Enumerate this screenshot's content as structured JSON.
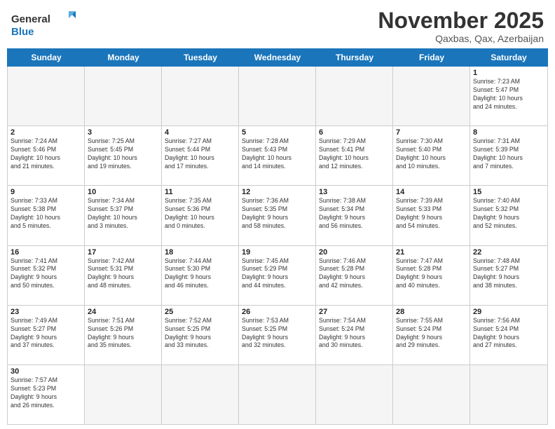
{
  "header": {
    "logo_general": "General",
    "logo_blue": "Blue",
    "month_title": "November 2025",
    "subtitle": "Qaxbas, Qax, Azerbaijan"
  },
  "weekdays": [
    "Sunday",
    "Monday",
    "Tuesday",
    "Wednesday",
    "Thursday",
    "Friday",
    "Saturday"
  ],
  "rows": [
    [
      {
        "day": "",
        "info": "",
        "empty": true
      },
      {
        "day": "",
        "info": "",
        "empty": true
      },
      {
        "day": "",
        "info": "",
        "empty": true
      },
      {
        "day": "",
        "info": "",
        "empty": true
      },
      {
        "day": "",
        "info": "",
        "empty": true
      },
      {
        "day": "",
        "info": "",
        "empty": true
      },
      {
        "day": "1",
        "info": "Sunrise: 7:23 AM\nSunset: 5:47 PM\nDaylight: 10 hours\nand 24 minutes."
      }
    ],
    [
      {
        "day": "2",
        "info": "Sunrise: 7:24 AM\nSunset: 5:46 PM\nDaylight: 10 hours\nand 21 minutes."
      },
      {
        "day": "3",
        "info": "Sunrise: 7:25 AM\nSunset: 5:45 PM\nDaylight: 10 hours\nand 19 minutes."
      },
      {
        "day": "4",
        "info": "Sunrise: 7:27 AM\nSunset: 5:44 PM\nDaylight: 10 hours\nand 17 minutes."
      },
      {
        "day": "5",
        "info": "Sunrise: 7:28 AM\nSunset: 5:43 PM\nDaylight: 10 hours\nand 14 minutes."
      },
      {
        "day": "6",
        "info": "Sunrise: 7:29 AM\nSunset: 5:41 PM\nDaylight: 10 hours\nand 12 minutes."
      },
      {
        "day": "7",
        "info": "Sunrise: 7:30 AM\nSunset: 5:40 PM\nDaylight: 10 hours\nand 10 minutes."
      },
      {
        "day": "8",
        "info": "Sunrise: 7:31 AM\nSunset: 5:39 PM\nDaylight: 10 hours\nand 7 minutes."
      }
    ],
    [
      {
        "day": "9",
        "info": "Sunrise: 7:33 AM\nSunset: 5:38 PM\nDaylight: 10 hours\nand 5 minutes."
      },
      {
        "day": "10",
        "info": "Sunrise: 7:34 AM\nSunset: 5:37 PM\nDaylight: 10 hours\nand 3 minutes."
      },
      {
        "day": "11",
        "info": "Sunrise: 7:35 AM\nSunset: 5:36 PM\nDaylight: 10 hours\nand 0 minutes."
      },
      {
        "day": "12",
        "info": "Sunrise: 7:36 AM\nSunset: 5:35 PM\nDaylight: 9 hours\nand 58 minutes."
      },
      {
        "day": "13",
        "info": "Sunrise: 7:38 AM\nSunset: 5:34 PM\nDaylight: 9 hours\nand 56 minutes."
      },
      {
        "day": "14",
        "info": "Sunrise: 7:39 AM\nSunset: 5:33 PM\nDaylight: 9 hours\nand 54 minutes."
      },
      {
        "day": "15",
        "info": "Sunrise: 7:40 AM\nSunset: 5:32 PM\nDaylight: 9 hours\nand 52 minutes."
      }
    ],
    [
      {
        "day": "16",
        "info": "Sunrise: 7:41 AM\nSunset: 5:32 PM\nDaylight: 9 hours\nand 50 minutes."
      },
      {
        "day": "17",
        "info": "Sunrise: 7:42 AM\nSunset: 5:31 PM\nDaylight: 9 hours\nand 48 minutes."
      },
      {
        "day": "18",
        "info": "Sunrise: 7:44 AM\nSunset: 5:30 PM\nDaylight: 9 hours\nand 46 minutes."
      },
      {
        "day": "19",
        "info": "Sunrise: 7:45 AM\nSunset: 5:29 PM\nDaylight: 9 hours\nand 44 minutes."
      },
      {
        "day": "20",
        "info": "Sunrise: 7:46 AM\nSunset: 5:28 PM\nDaylight: 9 hours\nand 42 minutes."
      },
      {
        "day": "21",
        "info": "Sunrise: 7:47 AM\nSunset: 5:28 PM\nDaylight: 9 hours\nand 40 minutes."
      },
      {
        "day": "22",
        "info": "Sunrise: 7:48 AM\nSunset: 5:27 PM\nDaylight: 9 hours\nand 38 minutes."
      }
    ],
    [
      {
        "day": "23",
        "info": "Sunrise: 7:49 AM\nSunset: 5:27 PM\nDaylight: 9 hours\nand 37 minutes."
      },
      {
        "day": "24",
        "info": "Sunrise: 7:51 AM\nSunset: 5:26 PM\nDaylight: 9 hours\nand 35 minutes."
      },
      {
        "day": "25",
        "info": "Sunrise: 7:52 AM\nSunset: 5:25 PM\nDaylight: 9 hours\nand 33 minutes."
      },
      {
        "day": "26",
        "info": "Sunrise: 7:53 AM\nSunset: 5:25 PM\nDaylight: 9 hours\nand 32 minutes."
      },
      {
        "day": "27",
        "info": "Sunrise: 7:54 AM\nSunset: 5:24 PM\nDaylight: 9 hours\nand 30 minutes."
      },
      {
        "day": "28",
        "info": "Sunrise: 7:55 AM\nSunset: 5:24 PM\nDaylight: 9 hours\nand 29 minutes."
      },
      {
        "day": "29",
        "info": "Sunrise: 7:56 AM\nSunset: 5:24 PM\nDaylight: 9 hours\nand 27 minutes."
      }
    ],
    [
      {
        "day": "30",
        "info": "Sunrise: 7:57 AM\nSunset: 5:23 PM\nDaylight: 9 hours\nand 26 minutes."
      },
      {
        "day": "",
        "info": "",
        "empty": true
      },
      {
        "day": "",
        "info": "",
        "empty": true
      },
      {
        "day": "",
        "info": "",
        "empty": true
      },
      {
        "day": "",
        "info": "",
        "empty": true
      },
      {
        "day": "",
        "info": "",
        "empty": true
      },
      {
        "day": "",
        "info": "",
        "empty": true
      }
    ]
  ]
}
